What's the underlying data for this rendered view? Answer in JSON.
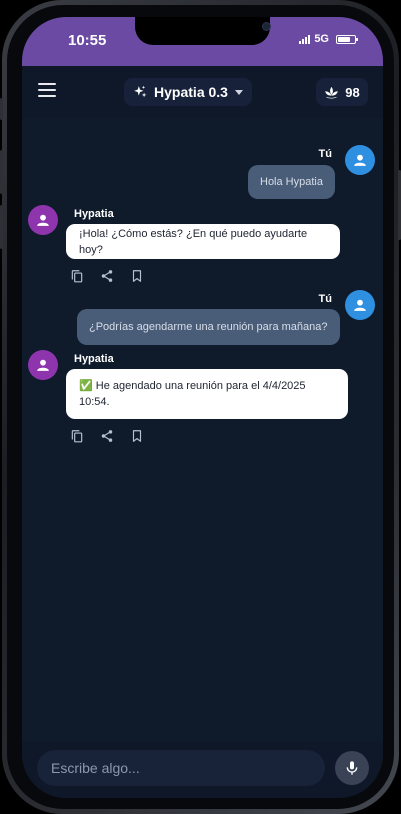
{
  "status_bar": {
    "time": "10:55",
    "network": "5G",
    "battery_level": 0.75
  },
  "header": {
    "model_name": "Hypatia 0.3",
    "credits": "98"
  },
  "messages": [
    {
      "role": "user",
      "sender": "Tú",
      "text": "Hola Hypatia"
    },
    {
      "role": "assistant",
      "sender": "Hypatia",
      "text": "¡Hola! ¿Cómo estás? ¿En qué puedo ayudarte hoy?"
    },
    {
      "role": "user",
      "sender": "Tú",
      "text": "¿Podrías agendarme una reunión para mañana?"
    },
    {
      "role": "assistant",
      "sender": "Hypatia",
      "text": "✅ He agendado una reunión para el 4/4/2025 10:54."
    }
  ],
  "input": {
    "placeholder": "Escribe algo..."
  },
  "icons": {
    "menu": "hamburger-menu-icon",
    "model": "sparkle-icon",
    "credits": "lotus-icon",
    "copy": "copy-icon",
    "share": "share-icon",
    "bookmark": "bookmark-icon",
    "mic": "microphone-icon"
  },
  "colors": {
    "status_bar": "#6a4aa3",
    "background": "#0f1a2b",
    "user_avatar": "#2f8fe0",
    "bot_avatar": "#8e35ad",
    "user_bubble": "#4a5d78",
    "bot_bubble": "#ffffff"
  }
}
